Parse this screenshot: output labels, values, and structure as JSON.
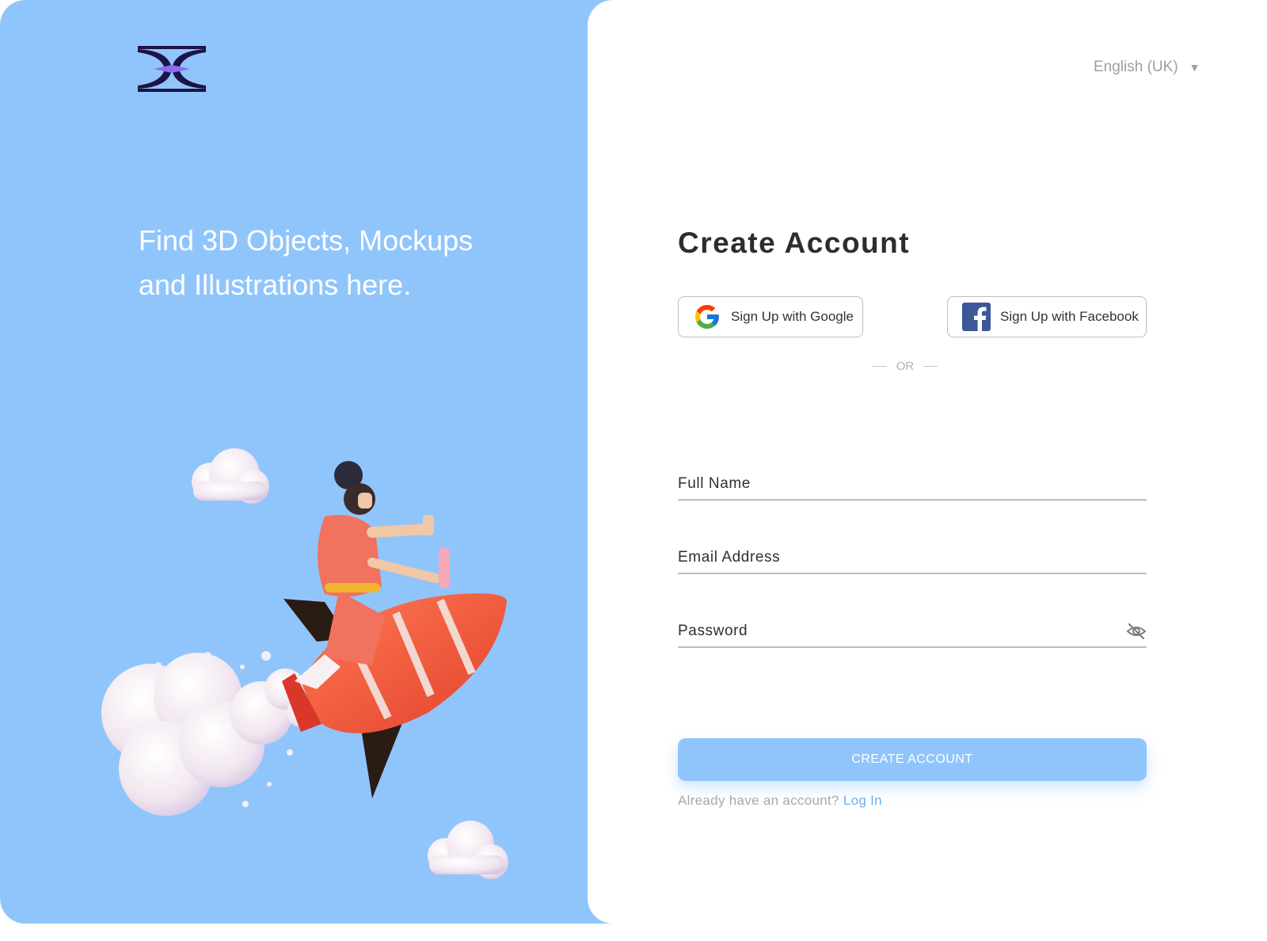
{
  "hero": {
    "tagline_line1": "Find 3D Objects, Mockups",
    "tagline_line2": "and Illustrations here."
  },
  "language": {
    "selected": "English (UK)",
    "caret": "▼"
  },
  "form": {
    "title": "Create Account",
    "google_button": "Sign Up with Google",
    "facebook_button": "Sign Up with Facebook",
    "divider": "OR",
    "fields": [
      {
        "label": "Full Name",
        "value": ""
      },
      {
        "label": "Email Address",
        "value": ""
      },
      {
        "label": "Password",
        "value": ""
      }
    ],
    "submit": "CREATE ACCOUNT",
    "login_prompt": "Already have an account?",
    "login_link": "Log In"
  },
  "colors": {
    "accent": "#90c5fc",
    "link": "#6aaef6",
    "logo_dark": "#1c1446",
    "logo_gem": "#8c6cf0"
  },
  "icons": [
    "logo-icon",
    "chevron-down-icon",
    "google-icon",
    "facebook-icon",
    "eye-off-icon"
  ]
}
